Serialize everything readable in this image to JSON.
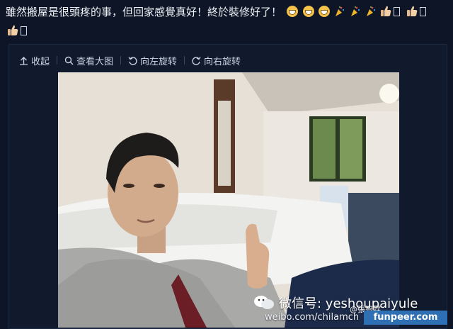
{
  "post": {
    "text": "雖然搬屋是很頭疼的事，但回家感覺真好！終於裝修好了！"
  },
  "emojis": [
    {
      "name": "grin-emoji"
    },
    {
      "name": "grin-emoji"
    },
    {
      "name": "grin-emoji"
    },
    {
      "name": "party-popper-emoji"
    },
    {
      "name": "party-popper-emoji"
    },
    {
      "name": "party-popper-emoji"
    },
    {
      "name": "thumbs-up-emoji"
    },
    {
      "name": "thumbs-up-emoji"
    },
    {
      "name": "thumbs-up-emoji"
    }
  ],
  "toolbar": {
    "collapse": "收起",
    "view_large": "查看大图",
    "rotate_left": "向左旋转",
    "rotate_right": "向右旋转"
  },
  "watermark": {
    "wechat_label": "微信号: yeshoupaiyule",
    "sub": "@張智霖",
    "weibo_url": "weibo.com/chilamch",
    "site": "funpeer.com"
  },
  "colors": {
    "background": "#0d1526",
    "badge": "#2f6fb3"
  }
}
